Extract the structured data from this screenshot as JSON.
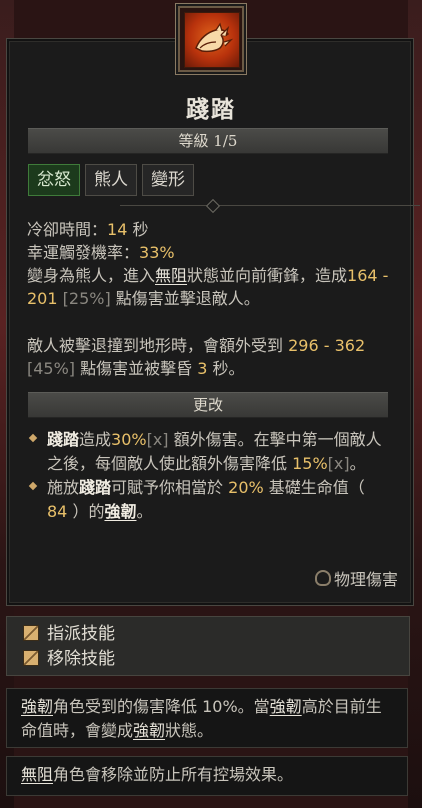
{
  "skill": {
    "name": "踐踏",
    "rank": "等級 1/5",
    "tags": [
      "忿怒",
      "熊人",
      "變形"
    ]
  },
  "stats": {
    "cooldown_label": "冷卻時間：",
    "cooldown_value": "14",
    "cooldown_unit": "秒",
    "lucky_label": "幸運觸發機率：",
    "lucky_value": "33%"
  },
  "description": {
    "p1_a": "變身為熊人，進入",
    "p1_kw": "無阻",
    "p1_b": "狀態並向前衝鋒，造成",
    "p1_dmg": "164 - 201",
    "p1_pct": "[25%]",
    "p1_c": "點傷害並擊退敵人。",
    "p2_a": "敵人被擊退撞到地形時，會額外受到",
    "p2_dmg": "296 - 362",
    "p2_pct": "[45%]",
    "p2_b": "點傷害並被擊昏",
    "p2_secs": "3",
    "p2_c": "秒。"
  },
  "modifiers": {
    "header": "更改",
    "m1_name": "踐踏",
    "m1_a": "造成",
    "m1_v1": "30%",
    "m1_x1": "[x]",
    "m1_b": "額外傷害。在擊中第一個敵人之後，每個敵人使此額外傷害降低",
    "m1_v2": "15%",
    "m1_x2": "[x]",
    "m1_c": "。",
    "m2_a": "施放",
    "m2_name": "踐踏",
    "m2_b": "可賦予你相當於",
    "m2_v1": "20%",
    "m2_c": "基礎生命值（",
    "m2_v2": "84",
    "m2_d": "）的",
    "m2_kw": "強韌",
    "m2_e": "。"
  },
  "damage_type": "物理傷害",
  "actions": {
    "assign": "指派技能",
    "remove": "移除技能"
  },
  "glossary": {
    "fortify_kw1": "強韌",
    "fortify_a": "角色受到的傷害降低 10%。當",
    "fortify_kw2": "強韌",
    "fortify_b": "高於目前生命值時，會變成",
    "fortify_kw3": "強韌",
    "fortify_c": "狀態。",
    "unstop_kw": "無阻",
    "unstop_a": "角色會移除並防止所有控場效果。"
  },
  "colors": {
    "value_highlight": "#e8c06a",
    "active_tag": "#1c3a1c",
    "icon_orange": "#d4561a"
  },
  "icons": [
    "bear-paw-icon",
    "bullet-diamond-icon",
    "physical-damage-icon",
    "keybind-icon"
  ]
}
